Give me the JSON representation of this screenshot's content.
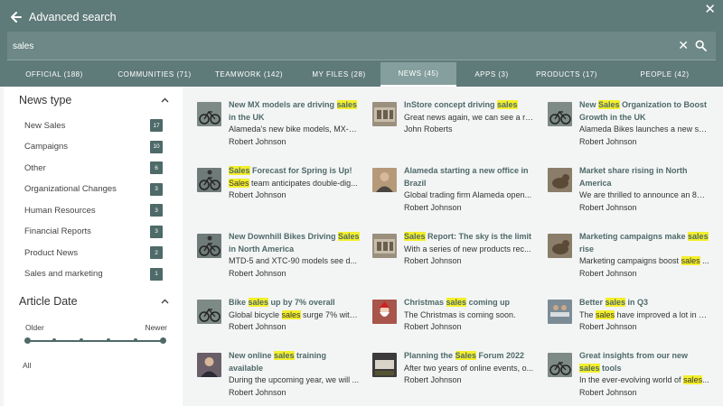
{
  "header": {
    "title": "Advanced search",
    "search_value": "sales",
    "colors": {
      "header_bg": "#5e7a79",
      "accent": "#4e6a69",
      "highlight": "#f3ef2b"
    }
  },
  "tabs": [
    {
      "label": "OFFICIAL (188)",
      "active": false
    },
    {
      "label": "COMMUNITIES (71)",
      "active": false
    },
    {
      "label": "TEAMWORK (142)",
      "active": false
    },
    {
      "label": "MY FILES (28)",
      "active": false
    },
    {
      "label": "NEWS (45)",
      "active": true
    },
    {
      "label": "APPS (3)",
      "active": false
    },
    {
      "label": "PRODUCTS (17)",
      "active": false
    },
    {
      "label": "PEOPLE (42)",
      "active": false
    }
  ],
  "sidebar": {
    "news_type": {
      "title": "News type",
      "items": [
        {
          "label": "New Sales",
          "count": "17"
        },
        {
          "label": "Campaigns",
          "count": "10"
        },
        {
          "label": "Other",
          "count": "6"
        },
        {
          "label": "Organizational Changes",
          "count": "3"
        },
        {
          "label": "Human Resources",
          "count": "3"
        },
        {
          "label": "Financial Reports",
          "count": "3"
        },
        {
          "label": "Product News",
          "count": "2"
        },
        {
          "label": "Sales and marketing",
          "count": "1"
        }
      ]
    },
    "article_date": {
      "title": "Article Date",
      "older_label": "Older",
      "newer_label": "Newer",
      "value": "All"
    }
  },
  "results": [
    {
      "title": "New MX models are driving sales in the UK",
      "desc": "Alameda's new bike models, MX-1...",
      "author": "Robert Johnson",
      "thumb": "bike"
    },
    {
      "title": "InStore concept driving sales",
      "desc": "Great news again, we can see a ris...",
      "author": "John Roberts",
      "thumb": "store"
    },
    {
      "title": "New Sales Organization to Boost Growth in the UK",
      "desc": "Alameda Bikes launches a new sal...",
      "author": "Robert Johnson",
      "thumb": "bike"
    },
    {
      "title": "Sales Forecast for Spring is Up!",
      "desc": "Sales team anticipates double-dig...",
      "author": "Robert Johnson",
      "thumb": "rider"
    },
    {
      "title": "Alameda starting a new office in Brazil",
      "desc": "Global trading firm Alameda open...",
      "author": "Robert Johnson",
      "thumb": "person"
    },
    {
      "title": "Market share rising in North America",
      "desc": "We are thrilled to announce an 8%...",
      "author": "Robert Johnson",
      "thumb": "dog"
    },
    {
      "title": "New Downhill Bikes Driving Sales in North America",
      "desc": "MTD-5 and XTC-90 models see d...",
      "author": "Robert Johnson",
      "thumb": "rider"
    },
    {
      "title": "Sales Report: The sky is the limit",
      "desc": "With a series of new products rec...",
      "author": "Robert Johnson",
      "thumb": "store"
    },
    {
      "title": "Marketing campaigns make sales rise",
      "desc": "Marketing campaigns boost sales ...",
      "author": "Robert Johnson",
      "thumb": "dog"
    },
    {
      "title": "Bike sales up by 7% overall",
      "desc": "Global bicycle sales surge 7% with...",
      "author": "Robert Johnson",
      "thumb": "bike"
    },
    {
      "title": "Christmas sales coming up",
      "desc": "The Christmas is coming soon.",
      "author": "Robert Johnson",
      "thumb": "santa"
    },
    {
      "title": "Better sales in Q3",
      "desc": "The sales have improved a lot in Q...",
      "author": "Robert Johnson",
      "thumb": "office"
    },
    {
      "title": "New online sales training available",
      "desc": "During the upcoming year, we will ...",
      "author": "Robert Johnson",
      "thumb": "woman"
    },
    {
      "title": "Planning the Sales Forum 2022",
      "desc": "After two years of online events, o...",
      "author": "Robert Johnson",
      "thumb": "stage"
    },
    {
      "title": "Great insights from our new sales tools",
      "desc": "In the ever-evolving world of sales...",
      "author": "Robert Johnson",
      "thumb": "bike"
    }
  ]
}
